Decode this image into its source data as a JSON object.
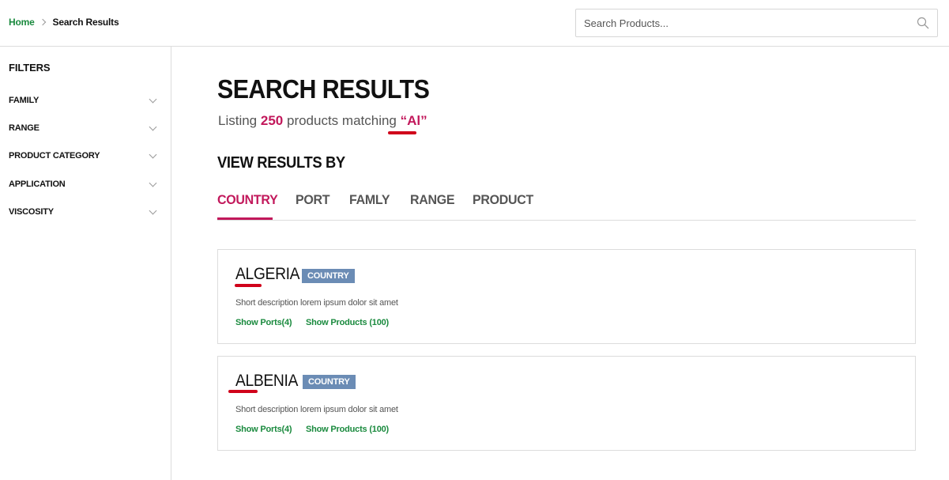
{
  "breadcrumb": {
    "home": "Home",
    "current": "Search Results"
  },
  "search": {
    "placeholder": "Search Products..."
  },
  "sidebar": {
    "title": "FILTERS",
    "filters": [
      {
        "label": "FAMILY"
      },
      {
        "label": "RANGE"
      },
      {
        "label": "PRODUCT CATEGORY"
      },
      {
        "label": "APPLICATION"
      },
      {
        "label": "VISCOSITY"
      }
    ]
  },
  "main": {
    "title": "SEARCH RESULTS",
    "listing": {
      "prefix": "Listing",
      "count": "250",
      "middle": "products matching",
      "query": "“Al”"
    },
    "view_by": "VIEW RESULTS BY",
    "tabs": [
      {
        "label": "COUNTRY",
        "active": true
      },
      {
        "label": "PORT"
      },
      {
        "label": "FAMLY"
      },
      {
        "label": "RANGE"
      },
      {
        "label": "PRODUCT"
      }
    ],
    "results": [
      {
        "name": "ALGERIA",
        "badge": "COUNTRY",
        "description": "Short description lorem ipsum dolor sit amet",
        "ports_link": "Show Ports(4)",
        "products_link": "Show Products (100)"
      },
      {
        "name": "ALBENIA",
        "badge": "COUNTRY",
        "description": "Short description lorem ipsum dolor sit amet",
        "ports_link": "Show Ports(4)",
        "products_link": "Show Products (100)"
      }
    ]
  },
  "colors": {
    "accent": "#c2185b",
    "link_green": "#1a8a3e",
    "badge_blue": "#6b8cb5",
    "highlight_red": "#d0021b"
  }
}
